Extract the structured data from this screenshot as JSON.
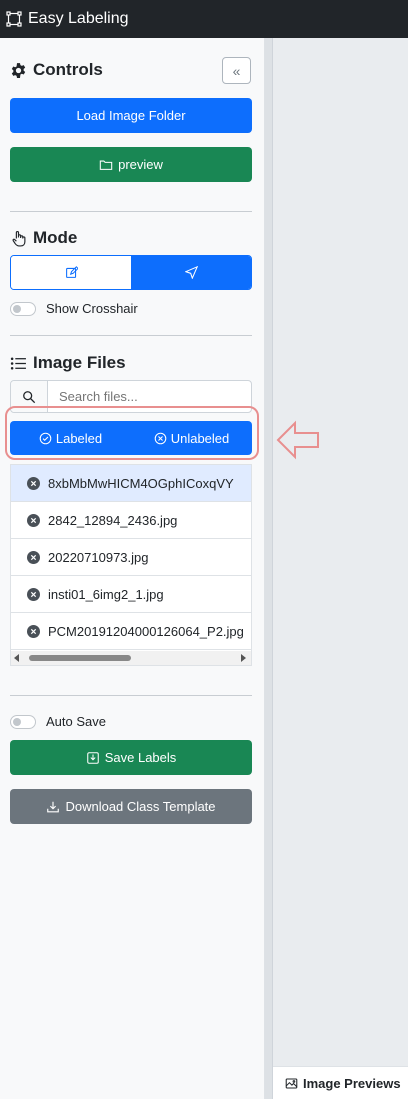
{
  "app": {
    "title": "Easy Labeling"
  },
  "controls": {
    "title": "Controls",
    "collapse_label": "«",
    "load_folder_label": "Load Image Folder",
    "preview_label": "preview"
  },
  "mode": {
    "title": "Mode",
    "selected": "navigate",
    "show_crosshair_label": "Show Crosshair"
  },
  "image_files": {
    "title": "Image Files",
    "search_placeholder": "Search files...",
    "filter_labeled": "Labeled",
    "filter_unlabeled": "Unlabeled",
    "files": [
      "8xbMbMwHICM4OGphICoxqVY",
      "2842_12894_2436.jpg",
      "20220710973.jpg",
      "insti01_6img2_1.jpg",
      "PCM20191204000126064_P2.jpg"
    ],
    "active_index": 0
  },
  "footer_controls": {
    "auto_save_label": "Auto Save",
    "save_labels": "Save Labels",
    "download_template": "Download Class Template"
  },
  "preview_panel": {
    "tab_label": "Image Previews"
  },
  "colors": {
    "primary": "#0d6efd",
    "success": "#198754",
    "secondary": "#6c757d",
    "annotation": "#e88f8f"
  }
}
